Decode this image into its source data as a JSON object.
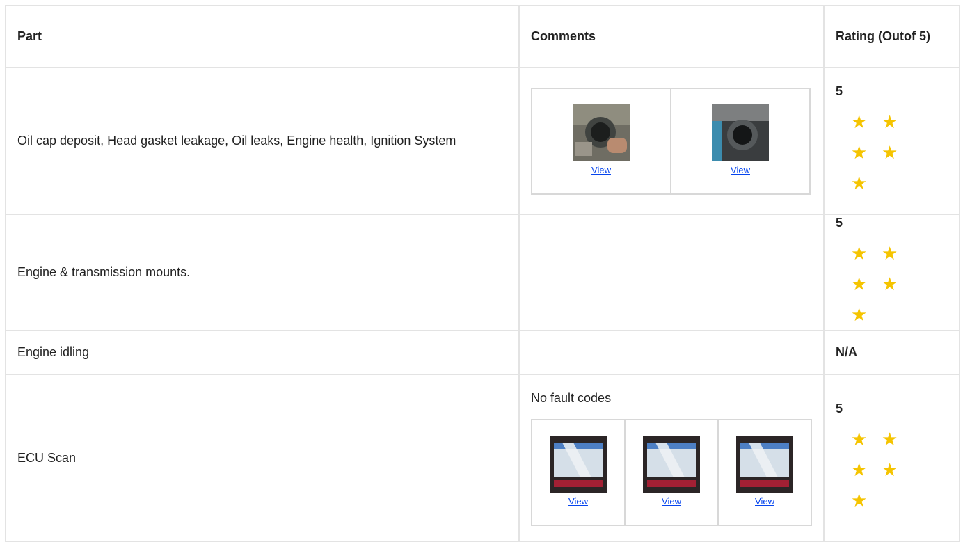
{
  "header": {
    "part": "Part",
    "comments": "Comments",
    "rating": "Rating (Outof 5)"
  },
  "rows": [
    {
      "part": "Oil cap deposit, Head gasket leakage, Oil leaks, Engine health, Ignition System",
      "rating": "5",
      "stars": 5,
      "images": [
        {
          "icon": "engine-photo-icon",
          "link": "View"
        },
        {
          "icon": "oil-filler-photo-icon",
          "link": "View"
        }
      ]
    },
    {
      "part": "Engine & transmission mounts.",
      "rating": "5",
      "stars": 5
    },
    {
      "part": "Engine idling",
      "rating": "N/A"
    },
    {
      "part": "ECU Scan",
      "comment": "No fault codes",
      "rating": "5",
      "stars": 5,
      "images": [
        {
          "icon": "scanner-photo-icon",
          "link": "View"
        },
        {
          "icon": "scanner-photo-icon",
          "link": "View"
        },
        {
          "icon": "scanner-photo-icon",
          "link": "View"
        }
      ]
    }
  ],
  "colors": {
    "star": "#f5c400",
    "link": "#0645ee",
    "border": "#e3e3e3"
  }
}
